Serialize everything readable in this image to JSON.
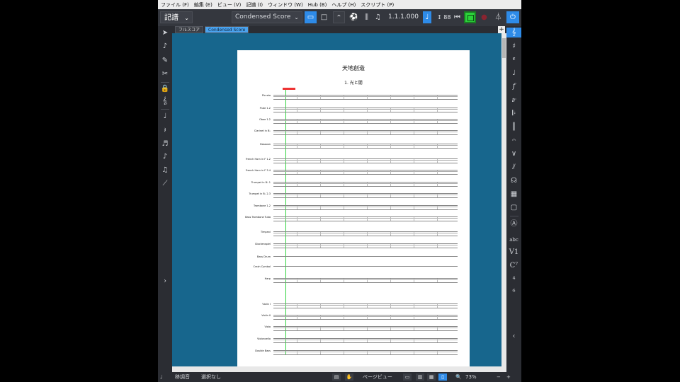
{
  "menu": [
    "ファイル (F)",
    "編集 (E)",
    "ビュー (V)",
    "記譜 (I)",
    "ウィンドウ (W)",
    "Hub (B)",
    "ヘルプ (H)",
    "スクリプト (P)"
  ],
  "toolbar": {
    "mode": "記譜",
    "layout": "Condensed Score",
    "position": "1.1.1.000",
    "tempo": "88"
  },
  "tabs": [
    "フルスコア",
    "Condensed Score"
  ],
  "score": {
    "title": "天地創造",
    "movement": "1. 光と闇",
    "instruments": [
      "Piccolo",
      "Flute 1.2",
      "Oboe 1.2",
      "Clarinet in B♭",
      "Bassoon",
      "French Horn in F 1.2",
      "French Horn in F 3.4",
      "Trumpet in B♭ 1",
      "Trumpet in B♭ 2.3",
      "Trombone 1.2",
      "Bass Trombone Tuba",
      "Timpani",
      "Glockenspiel",
      "Bass Drum",
      "Crash Cymbal",
      "Harp",
      "Violin I",
      "Violin II",
      "Viola",
      "Violoncello",
      "Double Bass"
    ]
  },
  "status": {
    "transpose": "移調音",
    "selection": "選択なし",
    "view": "ページビュー",
    "zoom": "73%"
  }
}
